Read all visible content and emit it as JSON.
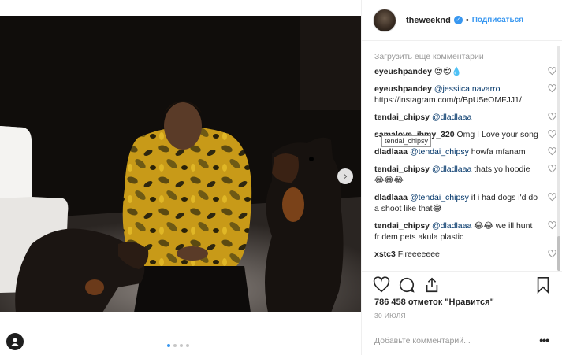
{
  "header": {
    "username": "theweeknd",
    "separator": "•",
    "follow_label": "Подписаться",
    "verified_icon": "verified-badge-icon"
  },
  "comments": {
    "load_more": "Загрузить еще комментарии",
    "items": [
      {
        "author": "eyeushpandey",
        "mention": "",
        "text": " 😍😍💧"
      },
      {
        "author": "eyeushpandey",
        "mention": "@jessiica.navarro",
        "text": " https://instagram.com/p/BpU5eOMFJJ1/"
      },
      {
        "author": "tendai_chipsy",
        "mention": "@dladlaaa",
        "text": ""
      },
      {
        "author": "samalove_jhmy_320",
        "mention": "",
        "text": " Omg I Love your song"
      },
      {
        "author": "dladlaaa",
        "mention": "@tendai_chipsy",
        "text": " howfa mfanam"
      },
      {
        "author": "tendai_chipsy",
        "mention": "@dladlaaa",
        "text": " thats yo hoodie 😂😂😂"
      },
      {
        "author": "dladlaaa",
        "mention": "@tendai_chipsy",
        "text": " if i had dogs i'd do a shoot like that😂"
      },
      {
        "author": "tendai_chipsy",
        "mention": "@dladlaaa",
        "text": " 😂😂 we ill hunt fr dem pets akula plastic"
      },
      {
        "author": "xstc3",
        "mention": "",
        "text": " Fireeeeeee"
      }
    ]
  },
  "tooltip": "tendai_chipsy",
  "actions": {
    "like_icon": "heart-icon",
    "comment_icon": "comment-icon",
    "share_icon": "share-icon",
    "save_icon": "bookmark-icon"
  },
  "likes": "786 458 отметок \"Нравится\"",
  "date": "30 ИЮЛЯ",
  "add_comment_placeholder": "Добавьте комментарий...",
  "more_options": "•••",
  "carousel": {
    "slide_count": 4,
    "active_index": 0,
    "next_icon": "chevron-right-icon"
  },
  "colors": {
    "accent": "#3897f0",
    "mention": "#003569",
    "muted": "#999999"
  }
}
